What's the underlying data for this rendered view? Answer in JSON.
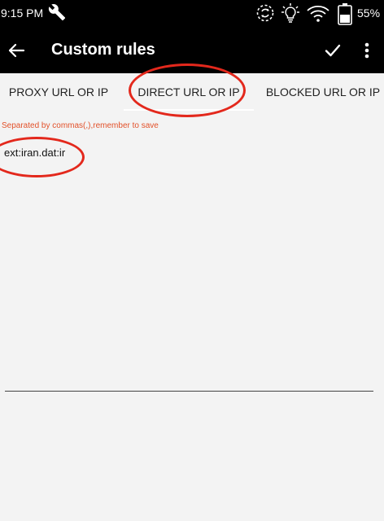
{
  "status_bar": {
    "time": "9:15 PM",
    "battery_percent": "55%",
    "icons": [
      "wrench-icon",
      "sync-icon",
      "bulb-icon",
      "wifi-icon",
      "battery-icon"
    ]
  },
  "app_bar": {
    "title": "Custom rules",
    "icons": [
      "back-arrow-icon",
      "check-icon",
      "more-vert-icon"
    ]
  },
  "tabs": [
    {
      "label": "PROXY URL OR IP",
      "selected": false
    },
    {
      "label": "DIRECT URL OR IP",
      "selected": true
    },
    {
      "label": "BLOCKED URL OR IP",
      "selected": false
    }
  ],
  "editor": {
    "hint": "Separated by commas(,),remember to save",
    "value": "ext:iran.dat:ir"
  },
  "colors": {
    "bar_background": "#000000",
    "page_background": "#f3f3f3",
    "hint_text": "#e2512a",
    "annotation_circle": "#e3281c"
  }
}
